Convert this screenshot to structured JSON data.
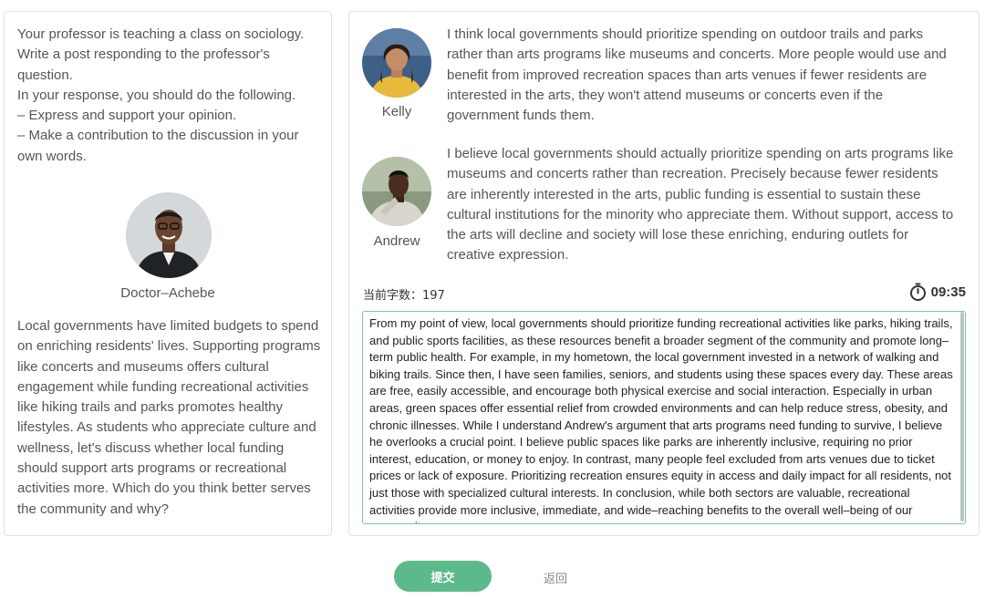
{
  "instructions": {
    "lines": [
      "Your professor is teaching a class on sociology. Write a post responding to the professor's question.",
      "In your response, you should do the following.",
      "– Express and support your opinion.",
      "– Make a contribution to the discussion in your own words."
    ]
  },
  "professor": {
    "name": "Doctor–Achebe",
    "question": "Local governments have limited budgets to spend on enriching residents' lives. Supporting programs like concerts and museums offers cultural engagement while funding recreational activities like hiking trails and parks promotes healthy lifestyles. As students who appreciate culture and wellness, let's discuss whether local funding should support arts programs or recreational activities more. Which do you think better serves the community and why?"
  },
  "students": [
    {
      "name": "Kelly",
      "text": "I think local governments should prioritize spending on outdoor trails and parks rather than arts programs like museums and concerts. More people would use and benefit from improved recreation spaces than arts venues if fewer residents are interested in the arts, they won't attend museums or concerts even if the government funds them."
    },
    {
      "name": "Andrew",
      "text": "I believe local governments should actually prioritize spending on arts programs like museums and concerts rather than recreation. Precisely because fewer residents are inherently interested in the arts, public funding is essential to sustain these cultural institutions for the minority who appreciate them. Without support, access to the arts will decline and society will lose these enriching, enduring outlets for creative expression."
    }
  ],
  "editor": {
    "word_count_label": "当前字数：197",
    "timer": "09:35",
    "essay": "From my point of view, local governments should prioritize funding recreational activities like parks, hiking trails, and public sports facilities, as these resources benefit a broader segment of the community and promote long–term public health. For example, in my hometown, the local government invested in a network of walking and biking trails. Since then, I have seen families, seniors, and students using these spaces every day. These areas are free, easily accessible, and encourage both physical exercise and social interaction. Especially in urban areas, green spaces offer essential relief from crowded environments and can help reduce stress, obesity, and chronic illnesses. While I understand Andrew's argument that arts programs need funding to survive, I believe he overlooks a crucial point. I believe public spaces like parks are inherently inclusive, requiring no prior interest, education, or money to enjoy. In contrast, many people feel excluded from arts venues due to ticket prices or lack of exposure. Prioritizing recreation ensures equity in access and daily impact for all residents, not just those with specialized cultural interests. In conclusion, while both sectors are valuable, recreational activities provide more inclusive, immediate, and wide–reaching benefits to the overall well–being of our community."
  },
  "actions": {
    "submit_label": "提交",
    "back_label": "返回"
  },
  "colors": {
    "accent": "#5cb98a",
    "editor_border": "#7fc6a4"
  }
}
